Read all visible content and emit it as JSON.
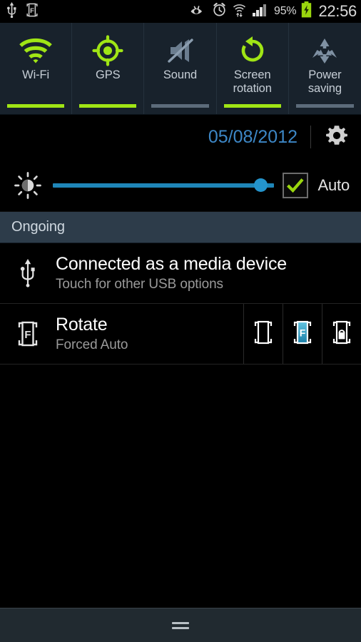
{
  "statusbar": {
    "left_icons": [
      {
        "name": "usb-icon",
        "label": "USB"
      },
      {
        "name": "rotation-forced-icon",
        "label": "F"
      }
    ],
    "right_icons": [
      {
        "name": "smart-stay-eye-icon",
        "label": "Smart stay"
      },
      {
        "name": "alarm-clock-icon",
        "label": "Alarm"
      },
      {
        "name": "wifi-transfer-icon",
        "label": "Wi-Fi"
      },
      {
        "name": "signal-bars-icon",
        "label": "Signal"
      }
    ],
    "battery_percent": "95%",
    "battery_state": "charging",
    "clock": "22:56"
  },
  "toggles": [
    {
      "label": "Wi-Fi",
      "icon": "wifi-icon",
      "active": true
    },
    {
      "label": "GPS",
      "icon": "gps-icon",
      "active": true
    },
    {
      "label": "Sound",
      "icon": "sound-muted-icon",
      "active": false
    },
    {
      "label": "Screen\nrotation",
      "icon": "screen-rotation-icon",
      "active": true
    },
    {
      "label": "Power\nsaving",
      "icon": "power-saving-icon",
      "active": false
    }
  ],
  "toggle_labels": {
    "wifi": "Wi-Fi",
    "gps": "GPS",
    "sound": "Sound",
    "screen_rotation_line1": "Screen",
    "screen_rotation_line2": "rotation",
    "power_saving_line1": "Power",
    "power_saving_line2": "saving"
  },
  "date_row": {
    "date": "05/08/2012",
    "settings_icon": "gear-icon"
  },
  "brightness": {
    "icon": "brightness-icon",
    "slider_value": 94,
    "auto_label": "Auto",
    "auto_checked": true
  },
  "sections": [
    {
      "title": "Ongoing",
      "notifications": [
        {
          "icon": "usb-icon",
          "title": "Connected as a media device",
          "subtitle": "Touch for other USB options",
          "actions": []
        },
        {
          "icon": "rotation-forced-icon",
          "title": "Rotate",
          "subtitle": "Forced Auto",
          "actions": [
            {
              "name": "rotate-free-button",
              "icon": "phone-outline-icon",
              "selected": false
            },
            {
              "name": "rotate-forced-button",
              "icon": "phone-forced-icon",
              "selected": true
            },
            {
              "name": "rotate-locked-button",
              "icon": "phone-locked-icon",
              "selected": false
            }
          ]
        }
      ]
    }
  ],
  "handle": {
    "name": "drag-handle"
  },
  "colors": {
    "accent_green": "#a0e515",
    "accent_blue": "#3d87c6",
    "slider_blue": "#2494cc",
    "panel_bg": "#18222c",
    "section_bg": "#2d3c4a",
    "inactive_gray": "#5c6b7a",
    "handle_bg": "#212a30"
  }
}
